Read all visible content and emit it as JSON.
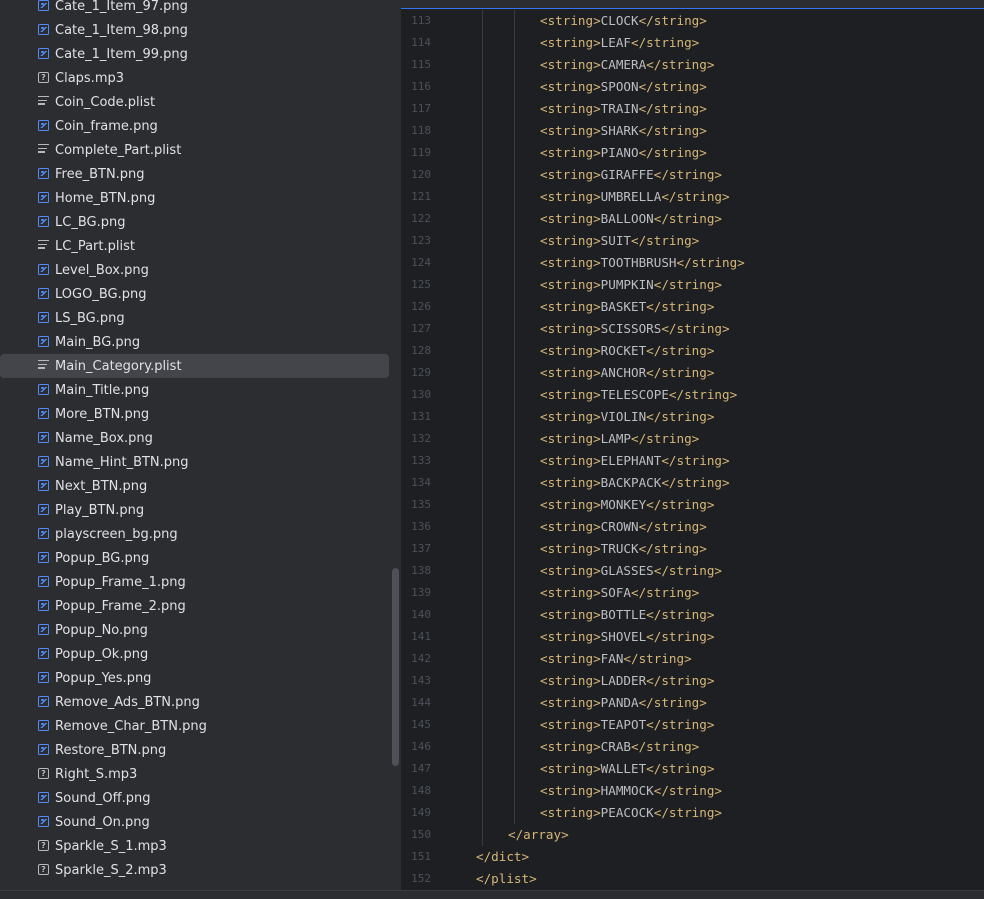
{
  "sidebar": {
    "files": [
      {
        "name": "Cate_1_Item_97.png",
        "type": "image"
      },
      {
        "name": "Cate_1_Item_98.png",
        "type": "image"
      },
      {
        "name": "Cate_1_Item_99.png",
        "type": "image"
      },
      {
        "name": "Claps.mp3",
        "type": "unknown"
      },
      {
        "name": "Coin_Code.plist",
        "type": "plist"
      },
      {
        "name": "Coin_frame.png",
        "type": "image"
      },
      {
        "name": "Complete_Part.plist",
        "type": "plist"
      },
      {
        "name": "Free_BTN.png",
        "type": "image"
      },
      {
        "name": "Home_BTN.png",
        "type": "image"
      },
      {
        "name": "LC_BG.png",
        "type": "image"
      },
      {
        "name": "LC_Part.plist",
        "type": "plist"
      },
      {
        "name": "Level_Box.png",
        "type": "image"
      },
      {
        "name": "LOGO_BG.png",
        "type": "image"
      },
      {
        "name": "LS_BG.png",
        "type": "image"
      },
      {
        "name": "Main_BG.png",
        "type": "image"
      },
      {
        "name": "Main_Category.plist",
        "type": "plist",
        "selected": true
      },
      {
        "name": "Main_Title.png",
        "type": "image"
      },
      {
        "name": "More_BTN.png",
        "type": "image"
      },
      {
        "name": "Name_Box.png",
        "type": "image"
      },
      {
        "name": "Name_Hint_BTN.png",
        "type": "image"
      },
      {
        "name": "Next_BTN.png",
        "type": "image"
      },
      {
        "name": "Play_BTN.png",
        "type": "image"
      },
      {
        "name": "playscreen_bg.png",
        "type": "image"
      },
      {
        "name": "Popup_BG.png",
        "type": "image"
      },
      {
        "name": "Popup_Frame_1.png",
        "type": "image"
      },
      {
        "name": "Popup_Frame_2.png",
        "type": "image"
      },
      {
        "name": "Popup_No.png",
        "type": "image"
      },
      {
        "name": "Popup_Ok.png",
        "type": "image"
      },
      {
        "name": "Popup_Yes.png",
        "type": "image"
      },
      {
        "name": "Remove_Ads_BTN.png",
        "type": "image"
      },
      {
        "name": "Remove_Char_BTN.png",
        "type": "image"
      },
      {
        "name": "Restore_BTN.png",
        "type": "image"
      },
      {
        "name": "Right_S.mp3",
        "type": "unknown"
      },
      {
        "name": "Sound_Off.png",
        "type": "image"
      },
      {
        "name": "Sound_On.png",
        "type": "image"
      },
      {
        "name": "Sparkle_S_1.mp3",
        "type": "unknown"
      },
      {
        "name": "Sparkle_S_2.mp3",
        "type": "unknown"
      }
    ]
  },
  "icons": {
    "image": "image-file-icon",
    "plist": "text-file-icon",
    "unknown": "unknown-file-icon"
  },
  "editor": {
    "lines": [
      {
        "num": "113",
        "indent": 2,
        "open": "<string>",
        "text": "CLOCK",
        "close": "</string>"
      },
      {
        "num": "114",
        "indent": 2,
        "open": "<string>",
        "text": "LEAF",
        "close": "</string>"
      },
      {
        "num": "115",
        "indent": 2,
        "open": "<string>",
        "text": "CAMERA",
        "close": "</string>"
      },
      {
        "num": "116",
        "indent": 2,
        "open": "<string>",
        "text": "SPOON",
        "close": "</string>"
      },
      {
        "num": "117",
        "indent": 2,
        "open": "<string>",
        "text": "TRAIN",
        "close": "</string>"
      },
      {
        "num": "118",
        "indent": 2,
        "open": "<string>",
        "text": "SHARK",
        "close": "</string>"
      },
      {
        "num": "119",
        "indent": 2,
        "open": "<string>",
        "text": "PIANO",
        "close": "</string>"
      },
      {
        "num": "120",
        "indent": 2,
        "open": "<string>",
        "text": "GIRAFFE",
        "close": "</string>"
      },
      {
        "num": "121",
        "indent": 2,
        "open": "<string>",
        "text": "UMBRELLA",
        "close": "</string>"
      },
      {
        "num": "122",
        "indent": 2,
        "open": "<string>",
        "text": "BALLOON",
        "close": "</string>"
      },
      {
        "num": "123",
        "indent": 2,
        "open": "<string>",
        "text": "SUIT",
        "close": "</string>"
      },
      {
        "num": "124",
        "indent": 2,
        "open": "<string>",
        "text": "TOOTHBRUSH",
        "close": "</string>"
      },
      {
        "num": "125",
        "indent": 2,
        "open": "<string>",
        "text": "PUMPKIN",
        "close": "</string>"
      },
      {
        "num": "126",
        "indent": 2,
        "open": "<string>",
        "text": "BASKET",
        "close": "</string>"
      },
      {
        "num": "127",
        "indent": 2,
        "open": "<string>",
        "text": "SCISSORS",
        "close": "</string>"
      },
      {
        "num": "128",
        "indent": 2,
        "open": "<string>",
        "text": "ROCKET",
        "close": "</string>"
      },
      {
        "num": "129",
        "indent": 2,
        "open": "<string>",
        "text": "ANCHOR",
        "close": "</string>"
      },
      {
        "num": "130",
        "indent": 2,
        "open": "<string>",
        "text": "TELESCOPE",
        "close": "</string>"
      },
      {
        "num": "131",
        "indent": 2,
        "open": "<string>",
        "text": "VIOLIN",
        "close": "</string>"
      },
      {
        "num": "132",
        "indent": 2,
        "open": "<string>",
        "text": "LAMP",
        "close": "</string>"
      },
      {
        "num": "133",
        "indent": 2,
        "open": "<string>",
        "text": "ELEPHANT",
        "close": "</string>"
      },
      {
        "num": "134",
        "indent": 2,
        "open": "<string>",
        "text": "BACKPACK",
        "close": "</string>"
      },
      {
        "num": "135",
        "indent": 2,
        "open": "<string>",
        "text": "MONKEY",
        "close": "</string>"
      },
      {
        "num": "136",
        "indent": 2,
        "open": "<string>",
        "text": "CROWN",
        "close": "</string>"
      },
      {
        "num": "137",
        "indent": 2,
        "open": "<string>",
        "text": "TRUCK",
        "close": "</string>"
      },
      {
        "num": "138",
        "indent": 2,
        "open": "<string>",
        "text": "GLASSES",
        "close": "</string>"
      },
      {
        "num": "139",
        "indent": 2,
        "open": "<string>",
        "text": "SOFA",
        "close": "</string>"
      },
      {
        "num": "140",
        "indent": 2,
        "open": "<string>",
        "text": "BOTTLE",
        "close": "</string>"
      },
      {
        "num": "141",
        "indent": 2,
        "open": "<string>",
        "text": "SHOVEL",
        "close": "</string>"
      },
      {
        "num": "142",
        "indent": 2,
        "open": "<string>",
        "text": "FAN",
        "close": "</string>"
      },
      {
        "num": "143",
        "indent": 2,
        "open": "<string>",
        "text": "LADDER",
        "close": "</string>"
      },
      {
        "num": "144",
        "indent": 2,
        "open": "<string>",
        "text": "PANDA",
        "close": "</string>"
      },
      {
        "num": "145",
        "indent": 2,
        "open": "<string>",
        "text": "TEAPOT",
        "close": "</string>"
      },
      {
        "num": "146",
        "indent": 2,
        "open": "<string>",
        "text": "CRAB",
        "close": "</string>"
      },
      {
        "num": "147",
        "indent": 2,
        "open": "<string>",
        "text": "WALLET",
        "close": "</string>"
      },
      {
        "num": "148",
        "indent": 2,
        "open": "<string>",
        "text": "HAMMOCK",
        "close": "</string>"
      },
      {
        "num": "149",
        "indent": 2,
        "open": "<string>",
        "text": "PEACOCK",
        "close": "</string>"
      },
      {
        "num": "150",
        "indent": 1,
        "open": "</array>",
        "text": "",
        "close": ""
      },
      {
        "num": "151",
        "indent": 0,
        "open": "</dict>",
        "text": "",
        "close": ""
      },
      {
        "num": "152",
        "indent": 0,
        "open": "</plist>",
        "text": "",
        "close": ""
      }
    ]
  }
}
